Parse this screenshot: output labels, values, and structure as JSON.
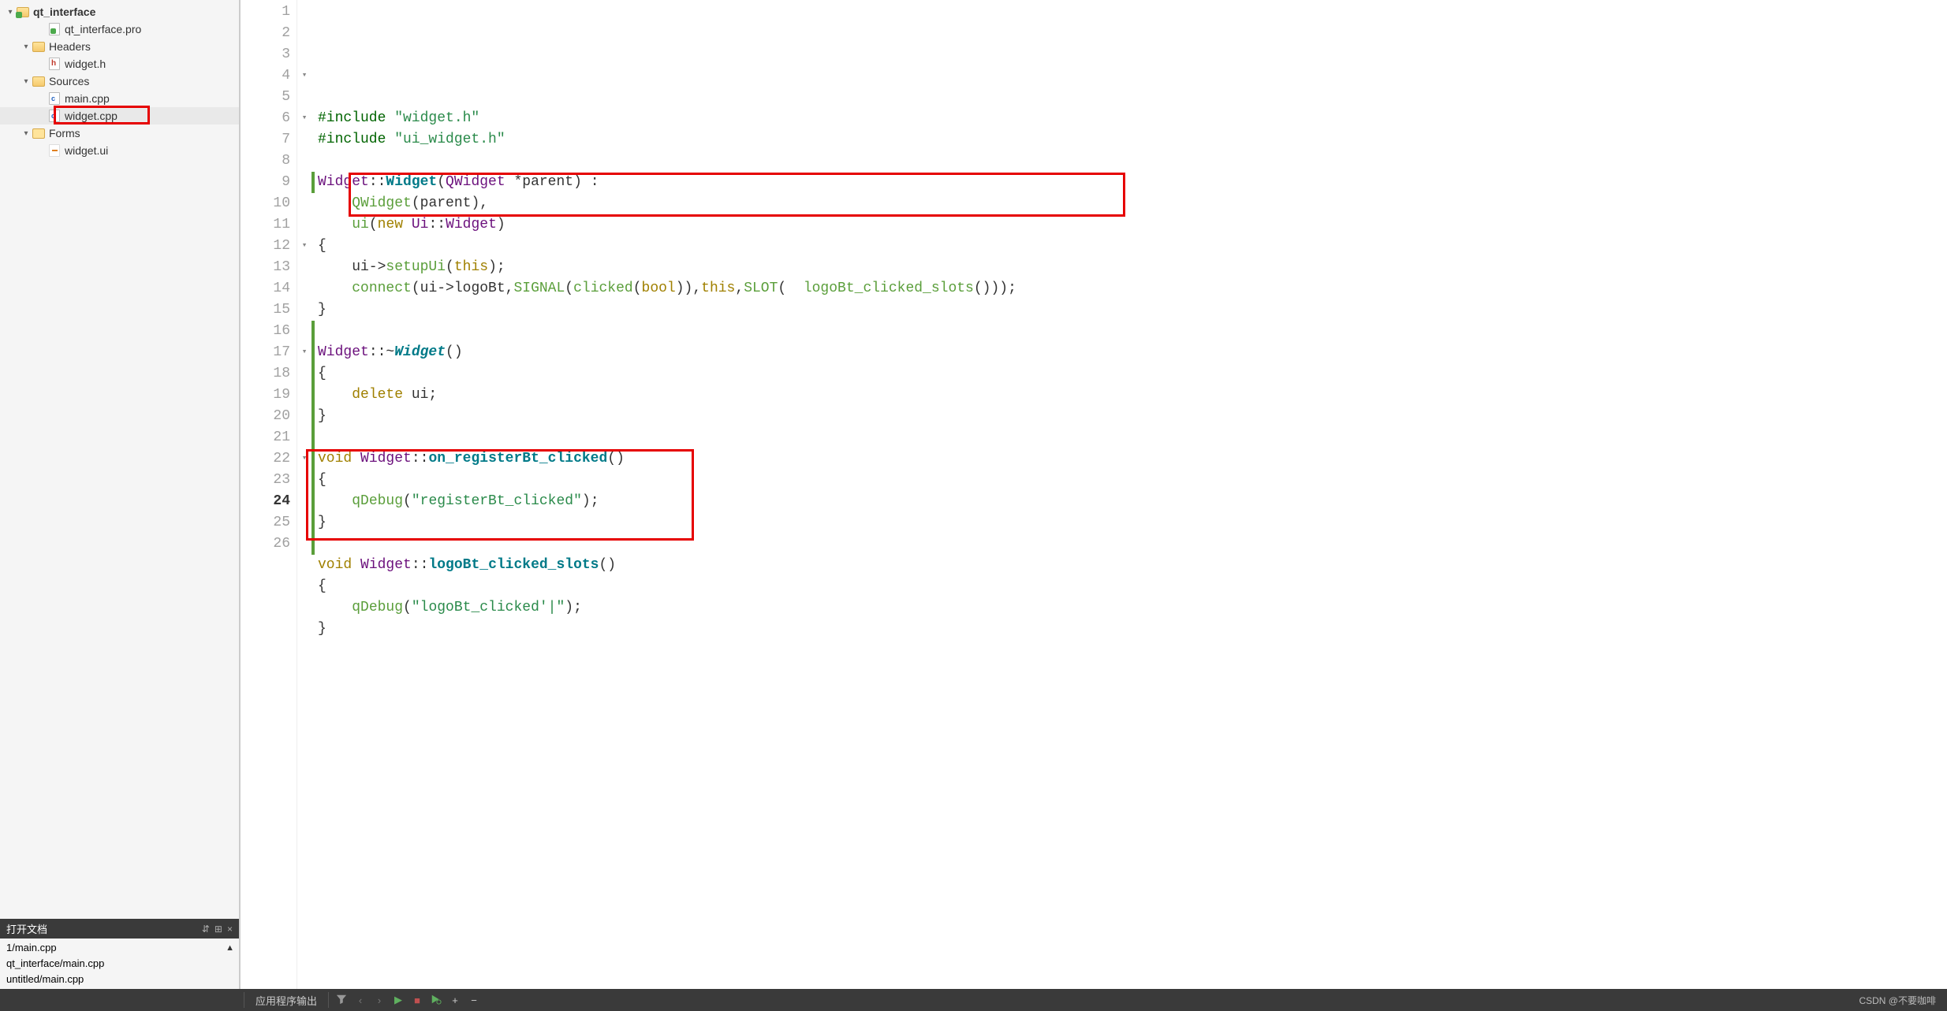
{
  "tree": {
    "project": "qt_interface",
    "pro_file": "qt_interface.pro",
    "headers_label": "Headers",
    "header_file": "widget.h",
    "sources_label": "Sources",
    "source_files": [
      "main.cpp",
      "widget.cpp"
    ],
    "forms_label": "Forms",
    "form_file": "widget.ui"
  },
  "open_docs": {
    "title": "打开文档",
    "items": [
      "1/main.cpp",
      "qt_interface/main.cpp",
      "untitled/main.cpp"
    ]
  },
  "editor": {
    "current_line": 24,
    "lines": [
      {
        "n": 1,
        "fold": "",
        "mod": false,
        "tokens": [
          [
            "#include ",
            "macro"
          ],
          [
            "\"widget.h\"",
            "str"
          ]
        ]
      },
      {
        "n": 2,
        "fold": "",
        "mod": false,
        "tokens": [
          [
            "#include ",
            "macro"
          ],
          [
            "\"ui_widget.h\"",
            "str"
          ]
        ]
      },
      {
        "n": 3,
        "fold": "",
        "mod": false,
        "tokens": []
      },
      {
        "n": 4,
        "fold": "▾",
        "mod": false,
        "tokens": [
          [
            "Widget",
            "type"
          ],
          [
            "::",
            ""
          ],
          [
            "Widget",
            "funcb"
          ],
          [
            "(",
            ""
          ],
          [
            "QWidget",
            "type"
          ],
          [
            " *parent) :",
            ""
          ]
        ]
      },
      {
        "n": 5,
        "fold": "",
        "mod": false,
        "tokens": [
          [
            "    ",
            ""
          ],
          [
            "QWidget",
            "func"
          ],
          [
            "(parent),",
            ""
          ]
        ]
      },
      {
        "n": 6,
        "fold": "▾",
        "mod": false,
        "tokens": [
          [
            "    ",
            ""
          ],
          [
            "ui",
            "func"
          ],
          [
            "(",
            ""
          ],
          [
            "new",
            "kw"
          ],
          [
            " ",
            ""
          ],
          [
            "Ui",
            "type"
          ],
          [
            "::",
            ""
          ],
          [
            "Widget",
            "type"
          ],
          [
            ")",
            ""
          ]
        ]
      },
      {
        "n": 7,
        "fold": "",
        "mod": false,
        "tokens": [
          [
            "{",
            ""
          ]
        ]
      },
      {
        "n": 8,
        "fold": "",
        "mod": false,
        "tokens": [
          [
            "    ui->",
            ""
          ],
          [
            "setupUi",
            "func"
          ],
          [
            "(",
            ""
          ],
          [
            "this",
            "kw"
          ],
          [
            ");",
            ""
          ]
        ]
      },
      {
        "n": 9,
        "fold": "",
        "mod": true,
        "tokens": [
          [
            "    ",
            ""
          ],
          [
            "connect",
            "func"
          ],
          [
            "(ui->logoBt,",
            ""
          ],
          [
            "SIGNAL",
            "func"
          ],
          [
            "(",
            ""
          ],
          [
            "clicked",
            "func"
          ],
          [
            "(",
            ""
          ],
          [
            "bool",
            "kw"
          ],
          [
            ")),",
            ""
          ],
          [
            "this",
            "kw"
          ],
          [
            ",",
            ""
          ],
          [
            "SLOT",
            "func"
          ],
          [
            "( ",
            ""
          ],
          [
            " ",
            ""
          ],
          [
            "logoBt_clicked_slots",
            "func"
          ],
          [
            "()));",
            ""
          ]
        ]
      },
      {
        "n": 10,
        "fold": "",
        "mod": false,
        "tokens": [
          [
            "}",
            ""
          ]
        ]
      },
      {
        "n": 11,
        "fold": "",
        "mod": false,
        "tokens": []
      },
      {
        "n": 12,
        "fold": "▾",
        "mod": false,
        "tokens": [
          [
            "Widget",
            "type"
          ],
          [
            "::~",
            ""
          ],
          [
            "Widget",
            "funcbi"
          ],
          [
            "()",
            ""
          ]
        ]
      },
      {
        "n": 13,
        "fold": "",
        "mod": false,
        "tokens": [
          [
            "{",
            ""
          ]
        ]
      },
      {
        "n": 14,
        "fold": "",
        "mod": false,
        "tokens": [
          [
            "    ",
            ""
          ],
          [
            "delete",
            "kw"
          ],
          [
            " ui;",
            ""
          ]
        ]
      },
      {
        "n": 15,
        "fold": "",
        "mod": false,
        "tokens": [
          [
            "}",
            ""
          ]
        ]
      },
      {
        "n": 16,
        "fold": "",
        "mod": true,
        "tokens": []
      },
      {
        "n": 17,
        "fold": "▾",
        "mod": true,
        "tokens": [
          [
            "void",
            "kw"
          ],
          [
            " ",
            ""
          ],
          [
            "Widget",
            "type"
          ],
          [
            "::",
            ""
          ],
          [
            "on_registerBt_clicked",
            "funcb"
          ],
          [
            "()",
            ""
          ]
        ]
      },
      {
        "n": 18,
        "fold": "",
        "mod": true,
        "tokens": [
          [
            "{",
            ""
          ]
        ]
      },
      {
        "n": 19,
        "fold": "",
        "mod": true,
        "tokens": [
          [
            "    ",
            ""
          ],
          [
            "qDebug",
            "func"
          ],
          [
            "(",
            ""
          ],
          [
            "\"registerBt_clicked\"",
            "str"
          ],
          [
            ");",
            ""
          ]
        ]
      },
      {
        "n": 20,
        "fold": "",
        "mod": true,
        "tokens": [
          [
            "}",
            ""
          ]
        ]
      },
      {
        "n": 21,
        "fold": "",
        "mod": true,
        "tokens": []
      },
      {
        "n": 22,
        "fold": "▾",
        "mod": true,
        "tokens": [
          [
            "void",
            "kw"
          ],
          [
            " ",
            ""
          ],
          [
            "Widget",
            "type"
          ],
          [
            "::",
            ""
          ],
          [
            "logoBt_clicked_slots",
            "funcb"
          ],
          [
            "()",
            ""
          ]
        ]
      },
      {
        "n": 23,
        "fold": "",
        "mod": true,
        "tokens": [
          [
            "{",
            ""
          ]
        ]
      },
      {
        "n": 24,
        "fold": "",
        "mod": true,
        "tokens": [
          [
            "    ",
            ""
          ],
          [
            "qDebug",
            "func"
          ],
          [
            "(",
            ""
          ],
          [
            "\"logoBt_clicked'|\"",
            "str"
          ],
          [
            ");",
            ""
          ]
        ]
      },
      {
        "n": 25,
        "fold": "",
        "mod": true,
        "tokens": [
          [
            "}",
            ""
          ]
        ]
      },
      {
        "n": 26,
        "fold": "",
        "mod": true,
        "tokens": []
      }
    ]
  },
  "bottom_bar": {
    "output_label": "应用程序输出"
  },
  "watermark": "CSDN @不要咖啡"
}
